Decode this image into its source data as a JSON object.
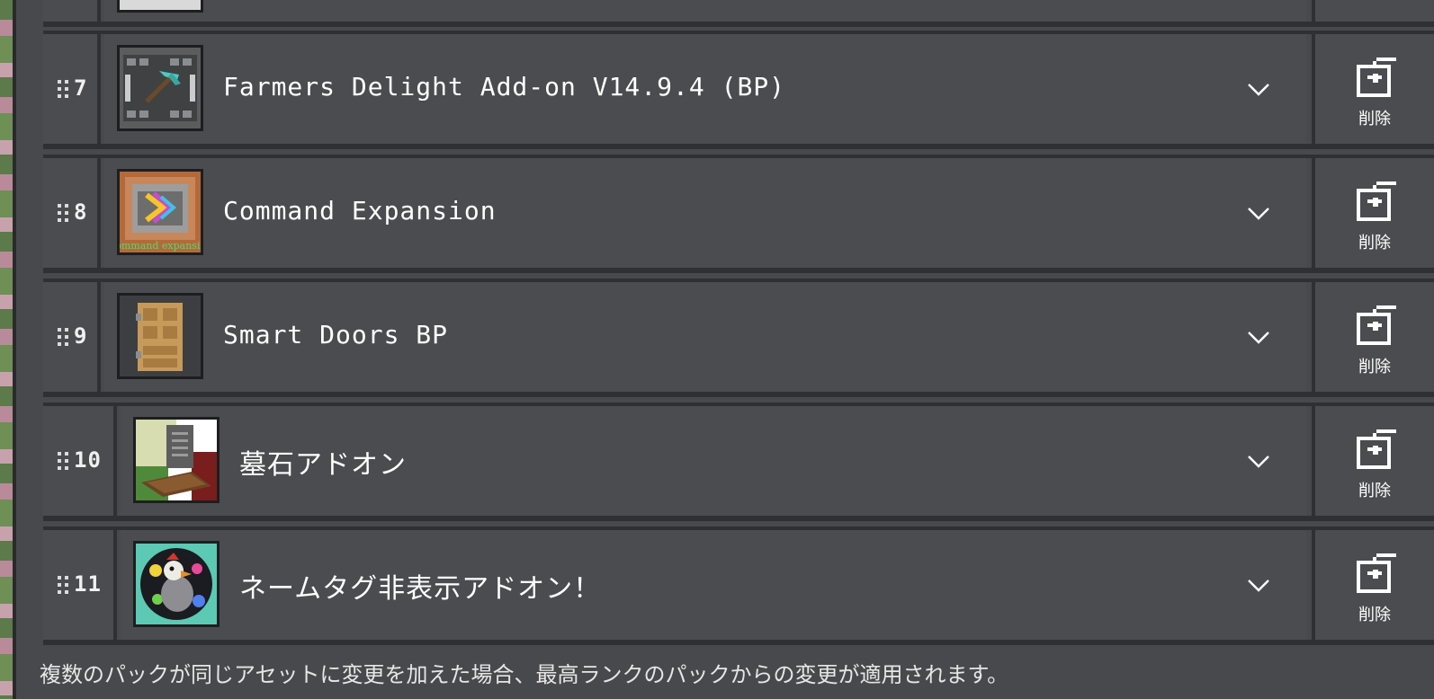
{
  "packs": [
    {
      "rank": "7",
      "name": "Farmers Delight Add-on V14.9.4 (BP)",
      "remove_label": "削除"
    },
    {
      "rank": "8",
      "name": "Command Expansion",
      "remove_label": "削除"
    },
    {
      "rank": "9",
      "name": "Smart Doors BP",
      "remove_label": "削除"
    },
    {
      "rank": "10",
      "name": "墓石アドオン",
      "remove_label": "削除"
    },
    {
      "rank": "11",
      "name": "ネームタグ非表示アドオン！",
      "remove_label": "削除"
    }
  ],
  "thumb_text": {
    "command_expansion": "Command expansion"
  },
  "footer_note": "複数のパックが同じアセットに変更を加えた場合、最高ランクのパックからの変更が適用されます。",
  "icons": {
    "drag": "drag-handle-icon",
    "expand": "chevron-down-icon",
    "remove": "remove-pack-icon"
  },
  "colors": {
    "panel": "#48494c",
    "cell": "#4b4c50",
    "divider": "#2f3033",
    "text": "#ffffff"
  }
}
